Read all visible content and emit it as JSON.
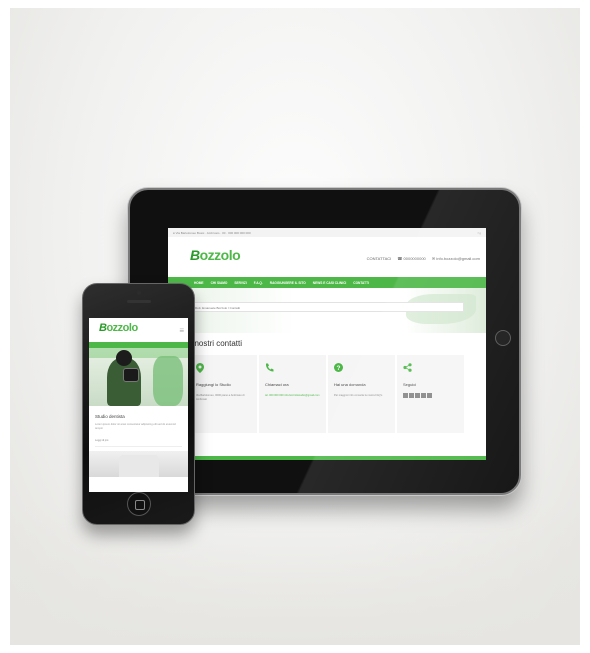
{
  "tablet": {
    "topbar": {
      "left": "● Via Bartolomeo Bossi · Ambrosio · 00 · 000 000 000 000",
      "right": "f  g"
    },
    "logo": {
      "initial": "B",
      "name": "ozzolo",
      "tagline": ""
    },
    "contacts": {
      "appointment": "CONTATTACI",
      "phone": "☎ 0000000000",
      "email": "✉ info.bozzolo@gmail.com"
    },
    "nav": [
      "HOME",
      "CHI SIAMO",
      "SERVIZI",
      "F.A.Q.",
      "RAGGIUNGERE IL SITO",
      "NEWS E CASI CLINICI",
      "CONTATTI"
    ],
    "breadcrumb": "Dott. Emanuele Bozzolo / Contatti",
    "heading": "I nostri contatti",
    "cards": [
      {
        "icon": "⬤",
        "title": "Raggiungi lo Studio",
        "text": "Via Bartolomeo, 0000 piano a Ambrosio di Ambrosio",
        "text_green": false
      },
      {
        "icon": "☎",
        "title": "Chiamaci ora",
        "text": "tel. 000 000 000 info.bozzolostudio@gmail.com",
        "text_green": true
      },
      {
        "icon": "?",
        "title": "Hai una domanda",
        "text": "Per maggiori info consulta la nostra FAQ's",
        "text_green": false
      },
      {
        "icon": "<",
        "title": "Seguici",
        "text": "",
        "text_green": false
      }
    ]
  },
  "phone": {
    "logo": {
      "initial": "B",
      "name": "ozzolo"
    },
    "menu_icon": "≡",
    "title": "Studio dentista",
    "text": "Lorem ipsum dolor sit amet consectetur adipiscing elit sed do eiusmod tempor",
    "more": "Leggi di più"
  },
  "colors": {
    "brand_green": "#4db848",
    "dark_green": "#2a9a2a"
  },
  "icons": {
    "location": "map-pin-icon",
    "phone": "phone-icon",
    "question": "question-icon",
    "share": "share-icon",
    "social": [
      "facebook-icon",
      "twitter-icon",
      "google-plus-icon",
      "linkedin-icon",
      "instagram-icon"
    ]
  }
}
